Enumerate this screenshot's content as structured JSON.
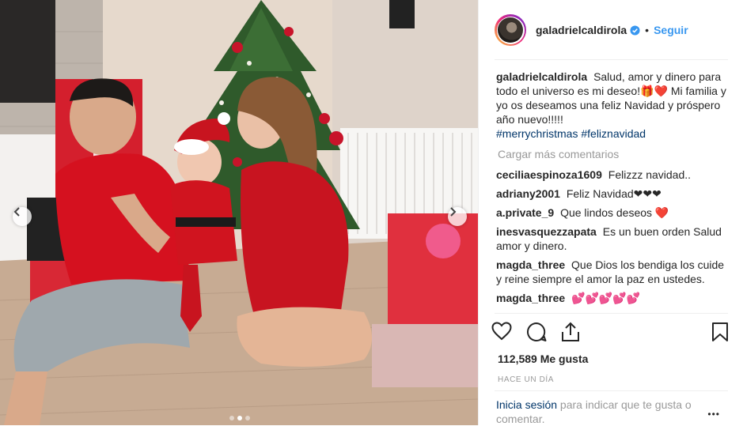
{
  "post": {
    "username": "galadrielcaldirola",
    "separator": "•",
    "follow_label": "Seguir",
    "caption": {
      "username": "galadrielcaldirola",
      "text": "Salud, amor y dinero para todo el universo es mi deseo!🎁❤️ Mi familia y yo os deseamos una feliz Navidad y próspero año nuevo!!!!!",
      "tag1": "#merrychristmas",
      "tag2": "#feliznavidad"
    },
    "load_more_label": "Cargar más comentarios",
    "comments": [
      {
        "username": "ceciliaespinoza1609",
        "text": "Felizzz navidad.."
      },
      {
        "username": "adriany2001",
        "text": "Feliz Navidad❤❤❤"
      },
      {
        "username": "a.private_9",
        "text": "Que lindos deseos ❤️"
      },
      {
        "username": "inesvasquezzapata",
        "text": "Es un buen orden Salud amor y dinero."
      },
      {
        "username": "magda_three",
        "text": "Que Dios los bendiga los cuide y reine siempre el amor la paz en ustedes."
      },
      {
        "username": "magda_three",
        "text": "💕💕💕💕💕"
      }
    ],
    "likes": "112,589 Me gusta",
    "time": "HACE UN DÍA",
    "login_link": "Inicia sesión",
    "login_text": " para indicar que te gusta o comentar.",
    "more_options": "•••"
  },
  "icons": [
    "heart-icon",
    "comment-icon",
    "share-icon",
    "bookmark-icon",
    "verified-badge-icon",
    "chevron-left-icon",
    "chevron-right-icon"
  ],
  "colors": {
    "link_blue": "#3897f0",
    "tag_blue": "#003569",
    "muted": "#999999",
    "verified": "#3897f0"
  }
}
